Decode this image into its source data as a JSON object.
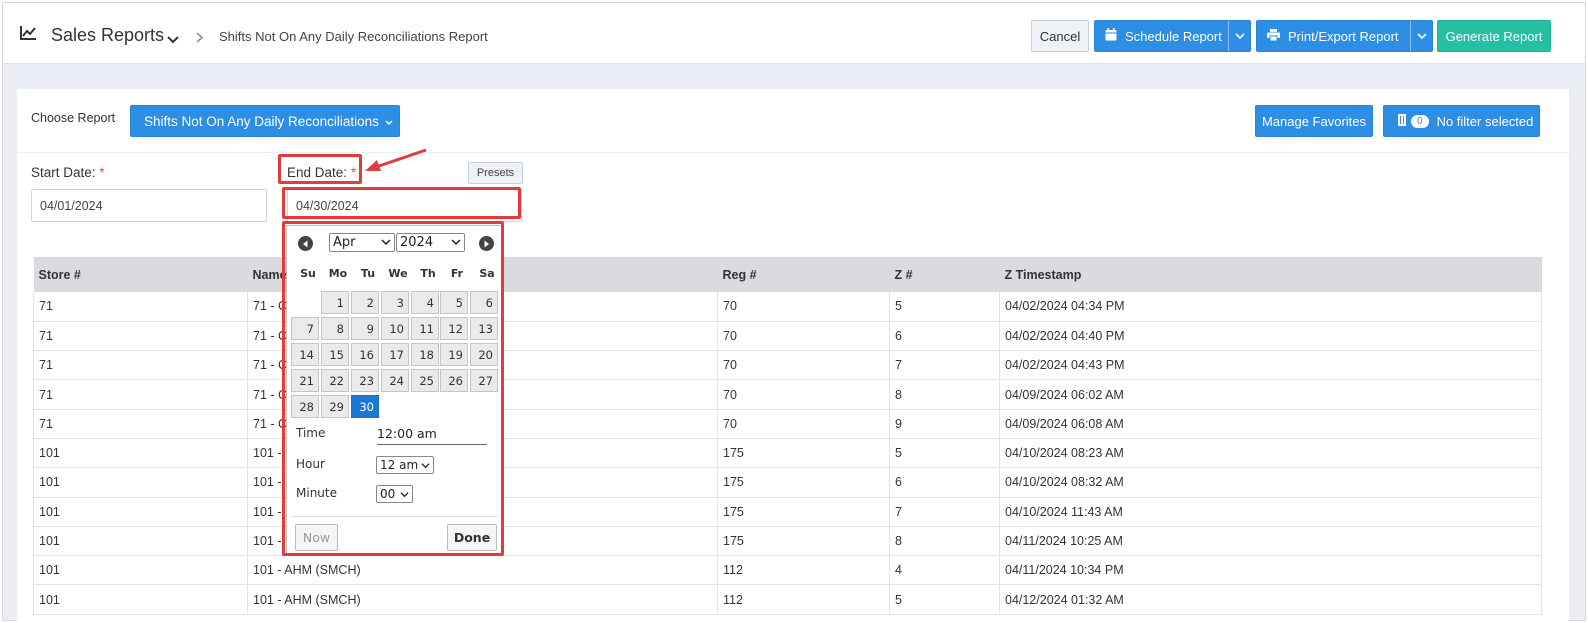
{
  "header": {
    "title": "Sales Reports",
    "breadcrumb": "Shifts Not On Any Daily Reconciliations Report",
    "cancel_label": "Cancel",
    "schedule_label": "Schedule Report",
    "print_label": "Print/Export Report",
    "generate_label": "Generate Report"
  },
  "report": {
    "choose_label": "Choose Report",
    "selected": "Shifts Not On Any Daily Reconciliations",
    "favorites_label": "Manage Favorites",
    "filter_count": "0",
    "filter_label": "No filter selected"
  },
  "form": {
    "start_label": "Start Date:",
    "start_value": "04/01/2024",
    "end_label": "End Date:",
    "end_value": "04/30/2024",
    "required_mark": "*",
    "presets_label": "Presets"
  },
  "table": {
    "columns": [
      "Store #",
      "Name",
      "Reg #",
      "Z #",
      "Z Timestamp"
    ],
    "rows": [
      [
        "71",
        "71 - C",
        "70",
        "5",
        "04/02/2024 04:34 PM"
      ],
      [
        "71",
        "71 - C",
        "70",
        "6",
        "04/02/2024 04:40 PM"
      ],
      [
        "71",
        "71 - C",
        "70",
        "7",
        "04/02/2024 04:43 PM"
      ],
      [
        "71",
        "71 - C",
        "70",
        "8",
        "04/09/2024 06:02 AM"
      ],
      [
        "71",
        "71 - C",
        "70",
        "9",
        "04/09/2024 06:08 AM"
      ],
      [
        "101",
        "101 -",
        "175",
        "5",
        "04/10/2024 08:23 AM"
      ],
      [
        "101",
        "101 -",
        "175",
        "6",
        "04/10/2024 08:32 AM"
      ],
      [
        "101",
        "101 -",
        "175",
        "7",
        "04/10/2024 11:43 AM"
      ],
      [
        "101",
        "101 -",
        "175",
        "8",
        "04/11/2024 10:25 AM"
      ],
      [
        "101",
        "101 - AHM (SMCH)",
        "112",
        "4",
        "04/11/2024 10:34 PM"
      ],
      [
        "101",
        "101 - AHM (SMCH)",
        "112",
        "5",
        "04/12/2024 01:32 AM"
      ]
    ]
  },
  "datepicker": {
    "month": "Apr",
    "year": "2024",
    "days_of_week": [
      "Su",
      "Mo",
      "Tu",
      "We",
      "Th",
      "Fr",
      "Sa"
    ],
    "first_weekday_index": 1,
    "days_in_month": 30,
    "selected_day": 30,
    "time_label": "Time",
    "time_value": "12:00 am",
    "hour_label": "Hour",
    "hour_value": "12 am",
    "minute_label": "Minute",
    "minute_value": "00",
    "now_label": "Now",
    "done_label": "Done"
  },
  "colors": {
    "primary": "#2d8ee3",
    "generate": "#26bfa4",
    "highlight": "#e23b3b",
    "selected_day": "#1a78d6"
  },
  "icons": [
    "line-chart-icon",
    "chevron-down-icon",
    "chevron-right-icon",
    "calendar-icon",
    "printer-icon",
    "filter-icon",
    "prev-month-icon",
    "next-month-icon"
  ]
}
